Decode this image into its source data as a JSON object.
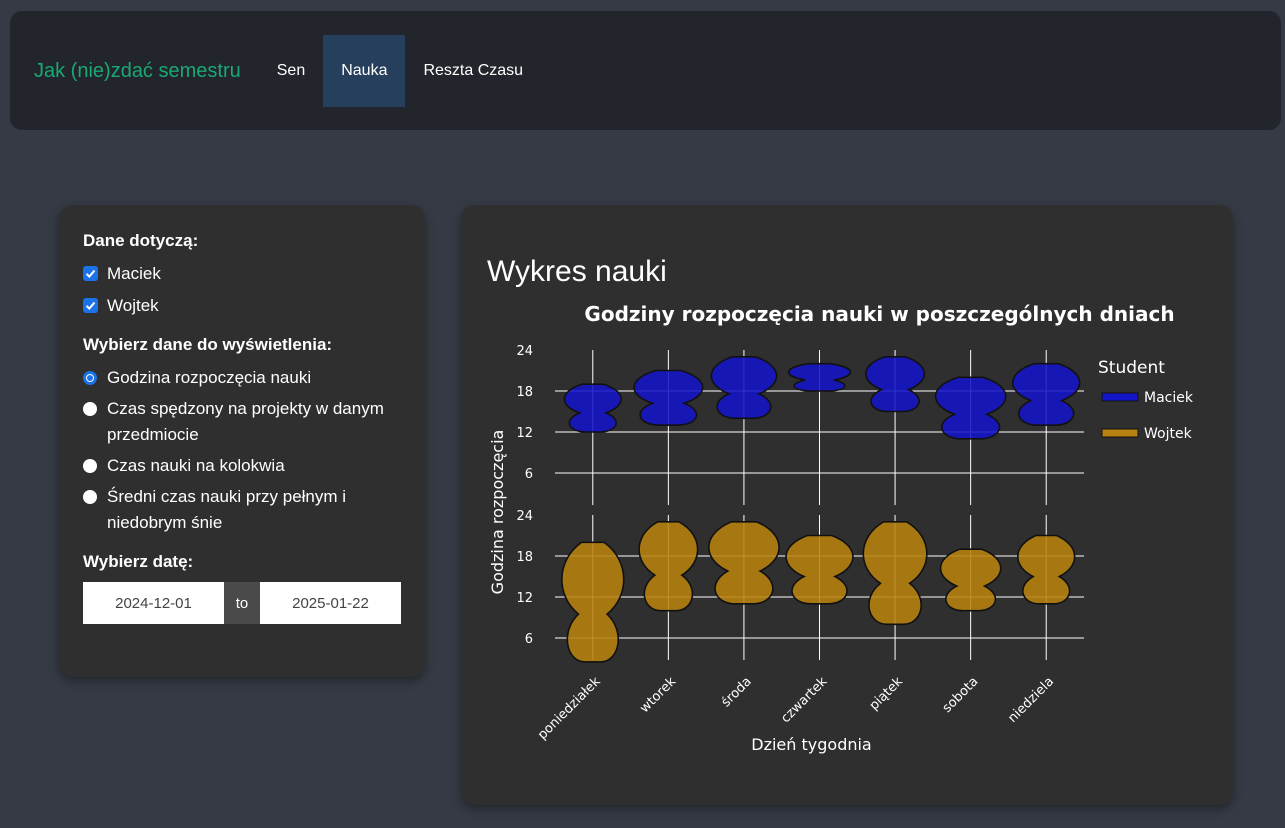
{
  "navbar": {
    "brand": "Jak (nie)zdać semestru",
    "links": [
      {
        "label": "Sen",
        "active": false
      },
      {
        "label": "Nauka",
        "active": true
      },
      {
        "label": "Reszta Czasu",
        "active": false
      }
    ]
  },
  "sidebar": {
    "students_title": "Dane dotyczą:",
    "students": [
      {
        "label": "Maciek",
        "checked": true
      },
      {
        "label": "Wojtek",
        "checked": true
      }
    ],
    "data_title": "Wybierz dane do wyświetlenia:",
    "options": [
      {
        "label": "Godzina rozpoczęcia nauki",
        "selected": true
      },
      {
        "label": "Czas spędzony na projekty w danym przedmiocie",
        "selected": false
      },
      {
        "label": "Czas nauki na kolokwia",
        "selected": false
      },
      {
        "label": "Średni czas nauki przy pełnym i niedobrym śnie",
        "selected": false
      }
    ],
    "date_title": "Wybierz datę:",
    "date_start": "2024-12-01",
    "date_sep": "to",
    "date_end": "2025-01-22"
  },
  "main": {
    "card_title": "Wykres nauki"
  },
  "colors": {
    "accent": "#19a974",
    "maciek": "#1515c8",
    "wojtek": "#b8820f",
    "active_nav": "#263f5c"
  },
  "chart_data": {
    "type": "violin",
    "title": "Godziny rozpoczęcia nauki w poszczególnych dniach",
    "xlabel": "Dzień tygodnia",
    "ylabel": "Godzina rozpoczęcia",
    "categories": [
      "poniedziałek",
      "wtorek",
      "środa",
      "czwartek",
      "piątek",
      "sobota",
      "niedziela"
    ],
    "yticks": [
      6,
      12,
      18,
      24
    ],
    "ylim": [
      2,
      26
    ],
    "legend_title": "Student",
    "legend_position": "right",
    "series": [
      {
        "name": "Maciek",
        "ranges": [
          [
            12,
            19
          ],
          [
            13,
            21
          ],
          [
            14,
            23
          ],
          [
            18,
            22
          ],
          [
            15,
            23
          ],
          [
            11,
            20
          ],
          [
            13,
            22
          ]
        ]
      },
      {
        "name": "Wojtek",
        "ranges": [
          [
            2.5,
            20
          ],
          [
            10,
            23
          ],
          [
            11,
            23
          ],
          [
            11,
            21
          ],
          [
            8,
            23
          ],
          [
            10,
            19
          ],
          [
            11,
            21
          ]
        ]
      }
    ]
  }
}
